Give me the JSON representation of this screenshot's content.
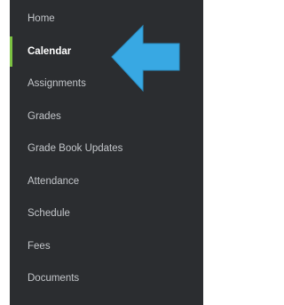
{
  "sidebar": {
    "items": [
      {
        "label": "Home",
        "active": false
      },
      {
        "label": "Calendar",
        "active": true
      },
      {
        "label": "Assignments",
        "active": false
      },
      {
        "label": "Grades",
        "active": false
      },
      {
        "label": "Grade Book Updates",
        "active": false
      },
      {
        "label": "Attendance",
        "active": false
      },
      {
        "label": "Schedule",
        "active": false
      },
      {
        "label": "Fees",
        "active": false
      },
      {
        "label": "Documents",
        "active": false
      }
    ]
  },
  "colors": {
    "sidebar_background": "#2b2d30",
    "text": "#c3c6ca",
    "active_text": "#ffffff",
    "active_indicator": "#7bc142",
    "annotation_arrow": "#38a8e3"
  },
  "annotation": {
    "icon": "left-arrow-icon",
    "points_to": "Calendar"
  }
}
